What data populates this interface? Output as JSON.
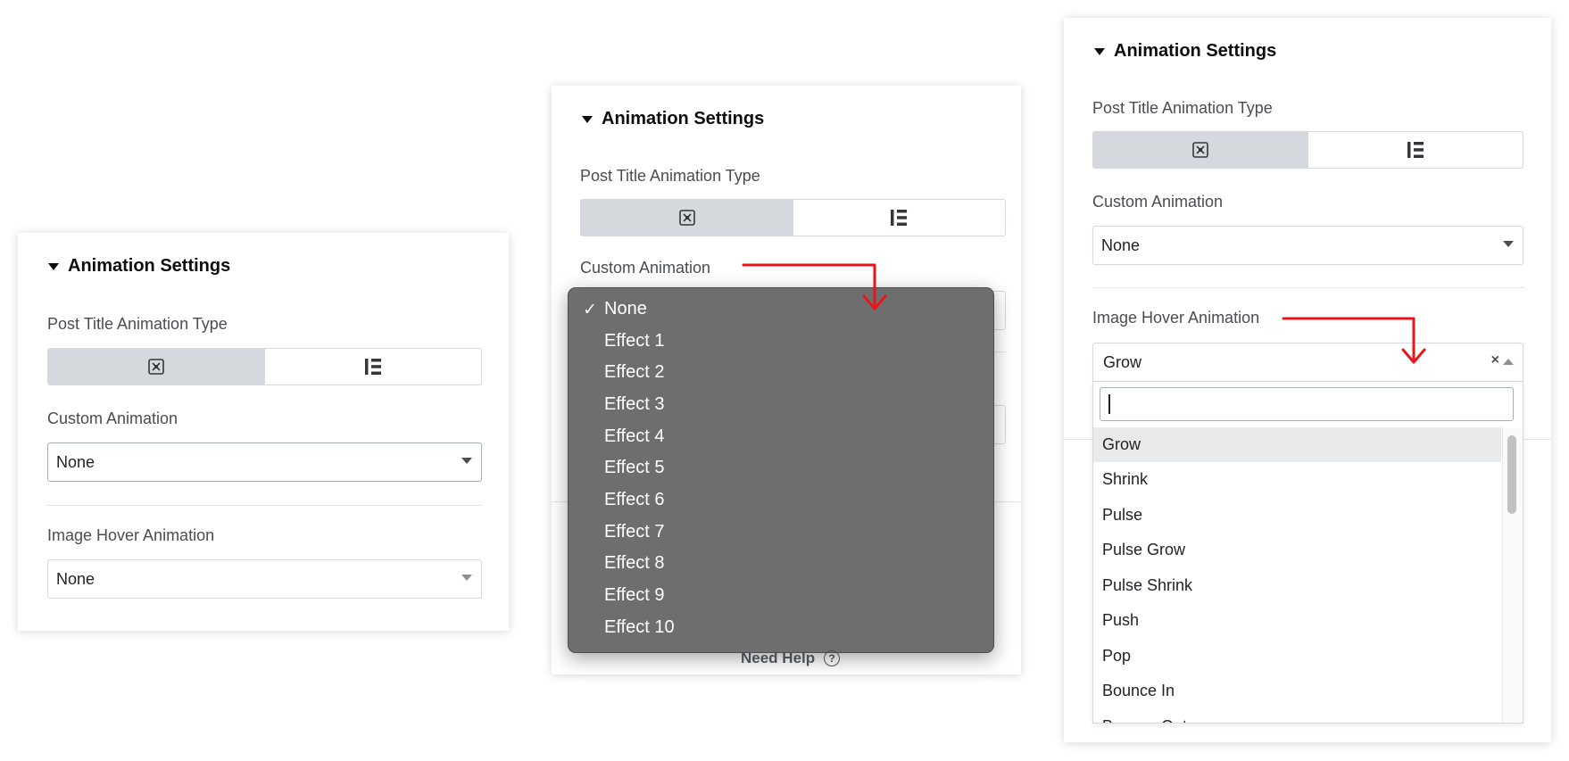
{
  "panel1": {
    "section_title": "Animation Settings",
    "post_title_label": "Post Title Animation Type",
    "custom_animation_label": "Custom Animation",
    "custom_animation_value": "None",
    "image_hover_label": "Image Hover Animation",
    "image_hover_value": "None"
  },
  "panel2": {
    "section_title": "Animation Settings",
    "post_title_label": "Post Title Animation Type",
    "custom_animation_label": "Custom Animation",
    "dropdown_options": [
      "None",
      "Effect 1",
      "Effect 2",
      "Effect 3",
      "Effect 4",
      "Effect 5",
      "Effect 6",
      "Effect 7",
      "Effect 8",
      "Effect 9",
      "Effect 10"
    ],
    "selected_option": "None",
    "check_mark": "✓",
    "need_help_label": "Need Help",
    "help_glyph": "?"
  },
  "panel3": {
    "section_title": "Animation Settings",
    "post_title_label": "Post Title Animation Type",
    "custom_animation_label": "Custom Animation",
    "custom_animation_value": "None",
    "image_hover_label": "Image Hover Animation",
    "image_hover_value": "Grow",
    "clear_glyph": "×",
    "search_value": "",
    "hover_options": [
      "Grow",
      "Shrink",
      "Pulse",
      "Pulse Grow",
      "Pulse Shrink",
      "Push",
      "Pop",
      "Bounce In",
      "Bounce Out"
    ],
    "highlighted_option": "Grow"
  },
  "colors": {
    "annotation_arrow": "#e8161b",
    "active_toggle": "#d5d8dc",
    "native_menu_bg": "#6e6e6e"
  },
  "icons": {
    "toggle_option_1": "elementor-logo-icon",
    "toggle_option_2": "custom-list-icon"
  }
}
